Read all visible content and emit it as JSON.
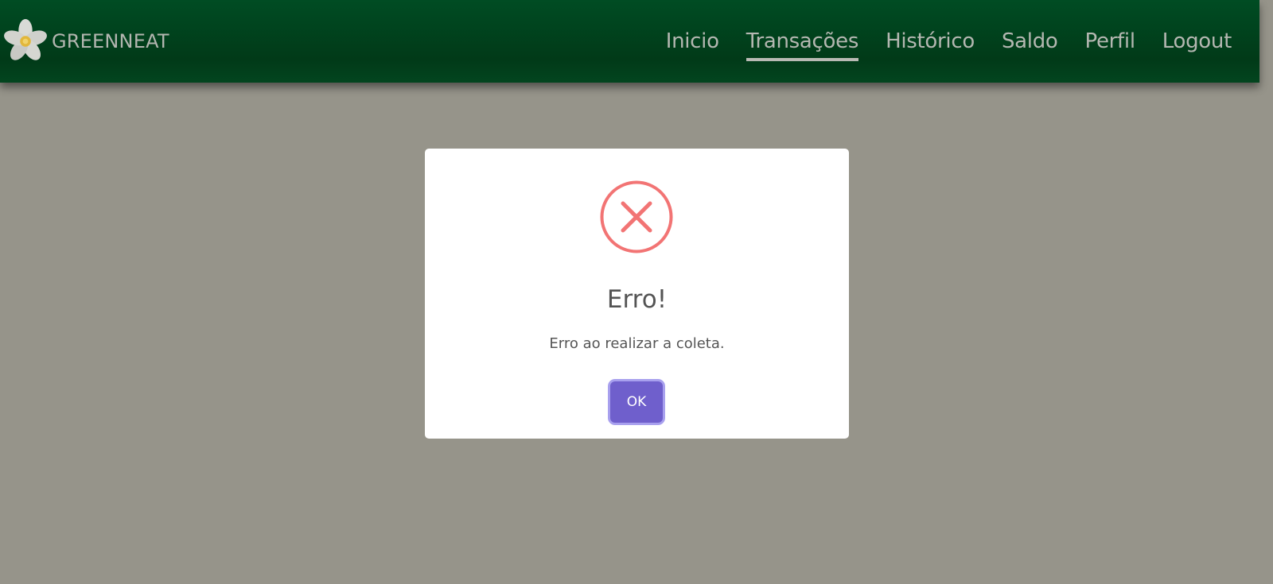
{
  "navbar": {
    "brand": "GREENNEAT",
    "items": [
      {
        "label": "Inicio",
        "active": false
      },
      {
        "label": "Transações",
        "active": true
      },
      {
        "label": "Histórico",
        "active": false
      },
      {
        "label": "Saldo",
        "active": false
      },
      {
        "label": "Perfil",
        "active": false
      },
      {
        "label": "Logout",
        "active": false
      }
    ]
  },
  "modal": {
    "icon": "error-x-circle-icon",
    "title": "Erro!",
    "text": "Erro ao realizar a coleta.",
    "confirm_label": "OK"
  },
  "colors": {
    "navbar": "#013a18",
    "overlay": "#96948a",
    "error": "#f27474",
    "button": "#6f5fcc"
  }
}
